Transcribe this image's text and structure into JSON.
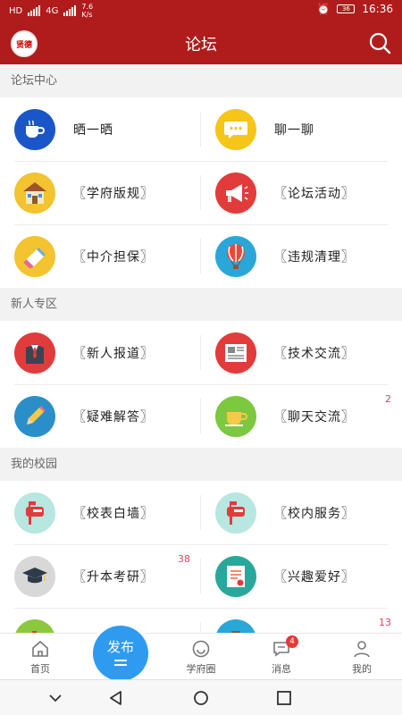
{
  "status": {
    "speed": "7.6",
    "speed_unit": "K/s",
    "net1": "HD",
    "net2": "4G",
    "time": "16:36",
    "battery": "36"
  },
  "appbar": {
    "title": "论坛",
    "avatar_text": "贤德"
  },
  "sections": [
    {
      "title": "论坛中心",
      "rows": [
        [
          {
            "label": "晒一晒",
            "icon": "coffee-cup-icon"
          },
          {
            "label": "聊一聊",
            "icon": "chat-bubble-icon"
          }
        ],
        [
          {
            "label": "〖学府版规〗",
            "icon": "house-icon"
          },
          {
            "label": "〖论坛活动〗",
            "icon": "megaphone-icon"
          }
        ],
        [
          {
            "label": "〖中介担保〗",
            "icon": "eraser-icon"
          },
          {
            "label": "〖违规清理〗",
            "icon": "hot-air-balloon-icon"
          }
        ]
      ]
    },
    {
      "title": "新人专区",
      "rows": [
        [
          {
            "label": "〖新人报道〗",
            "icon": "suit-icon"
          },
          {
            "label": "〖技术交流〗",
            "icon": "newspaper-icon"
          }
        ],
        [
          {
            "label": "〖疑难解答〗",
            "icon": "pencil-icon"
          },
          {
            "label": "〖聊天交流〗",
            "icon": "tea-cup-icon",
            "count": "2"
          }
        ]
      ]
    },
    {
      "title": "我的校园",
      "rows": [
        [
          {
            "label": "〖校表白墙〗",
            "icon": "mailbox-icon"
          },
          {
            "label": "〖校内服务〗",
            "icon": "mailbox-icon"
          }
        ],
        [
          {
            "label": "〖升本考研〗",
            "icon": "graduation-cap-icon",
            "count": "38"
          },
          {
            "label": "〖兴趣爱好〗",
            "icon": "certificate-icon"
          }
        ],
        [
          {
            "label": "",
            "icon": "books-icon"
          },
          {
            "label": "",
            "icon": "briefcase-icon",
            "count": "13"
          }
        ]
      ]
    }
  ],
  "tabs": {
    "home": "首页",
    "publish": "发布",
    "circle": "学府圈",
    "messages": "消息",
    "messages_badge": "4",
    "mine": "我的"
  },
  "colors": {
    "brand": "#b01c1c",
    "publish": "#2f9bf0",
    "badge": "#e2455a"
  }
}
